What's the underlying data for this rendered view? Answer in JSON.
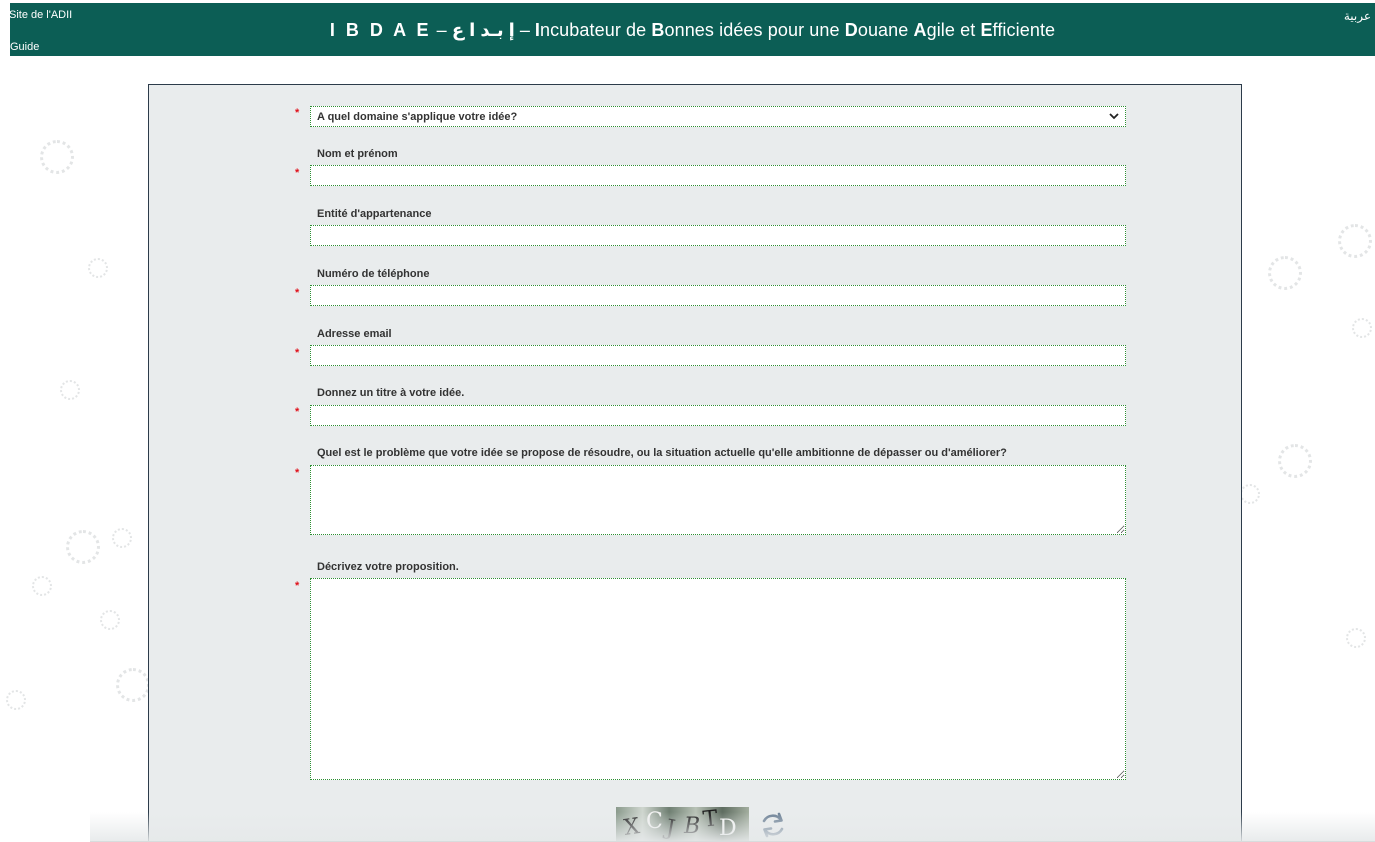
{
  "header": {
    "site_link": "Site de l'ADII",
    "guide_link": "Guide",
    "lang_link": "عربية",
    "title": {
      "acronym": "I B D A E",
      "arabic": "إ بـد ا ع",
      "separator": "–",
      "w1_cap": "I",
      "w1_rest": "ncubateur de ",
      "w2_cap": "B",
      "w2_rest": "onnes idées pour une ",
      "w3_cap": "D",
      "w3_rest": "ouane ",
      "w4_cap": "A",
      "w4_rest": "gile et ",
      "w5_cap": "E",
      "w5_rest": "fficiente"
    }
  },
  "form": {
    "required_mark": "*",
    "domain_select": {
      "value": "A quel domaine s'applique votre idée?"
    },
    "fields": {
      "nom": {
        "label": "Nom et prénom",
        "value": ""
      },
      "entite": {
        "label": "Entité d'appartenance",
        "value": ""
      },
      "telephone": {
        "label": "Numéro de téléphone",
        "value": ""
      },
      "email": {
        "label": "Adresse email",
        "value": ""
      },
      "titre": {
        "label": "Donnez un titre à votre idée.",
        "value": ""
      },
      "probleme": {
        "label": "Quel est le problème que votre idée se propose de résoudre, ou la situation actuelle qu'elle ambitionne de dépasser ou d'améliorer?",
        "value": ""
      },
      "proposition": {
        "label": "Décrivez votre proposition.",
        "value": ""
      }
    },
    "captcha": {
      "chars": [
        "X",
        "C",
        "J",
        "B",
        "T",
        "D"
      ]
    }
  },
  "colors": {
    "header_bg": "#0c5e55",
    "required": "#e0101a",
    "field_border": "#2e8f34",
    "panel_bg": "#e9eced"
  },
  "icons": {
    "select_arrow": "chevron-down-icon",
    "captcha_refresh": "refresh-icon"
  }
}
